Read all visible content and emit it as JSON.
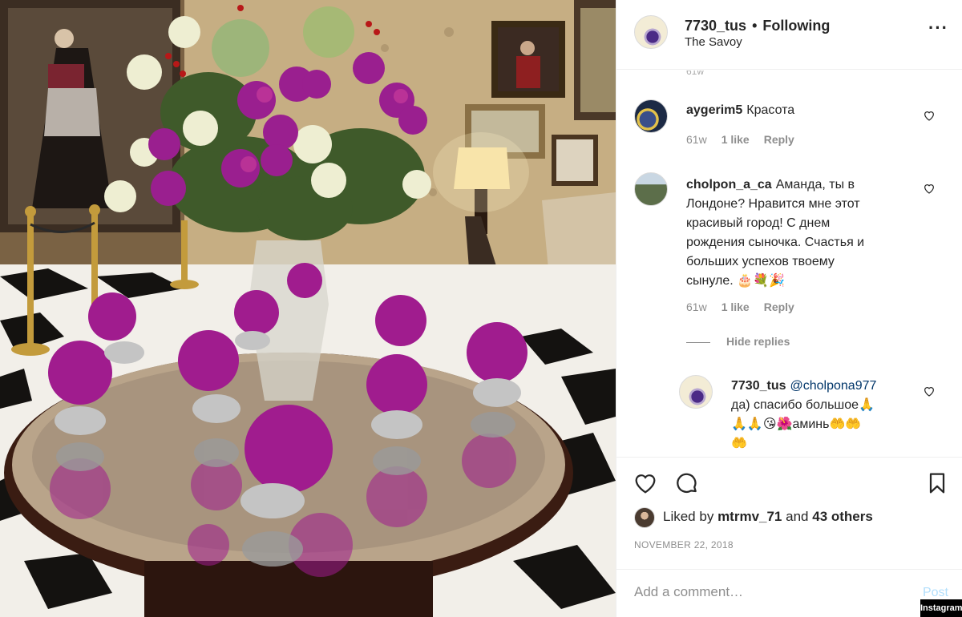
{
  "header": {
    "username": "7730_tus",
    "separator": "•",
    "follow_state": "Following",
    "location": "The Savoy",
    "more_icon": "more-dots-icon"
  },
  "comments": [
    {
      "user": "aygerim5",
      "text": "Красота",
      "time": "61w",
      "likes": "1 like",
      "reply": "Reply"
    },
    {
      "user": "cholpon_a_ca",
      "lines": [
        "Аманда, ты в",
        "Лондоне? Нравится мне этот",
        "красивый город! С днем",
        "рождения сыночка. Счастья и",
        "больших успехов твоему",
        "сынуле. 🎂💐🎉"
      ],
      "time": "61w",
      "likes": "1 like",
      "reply": "Reply"
    }
  ],
  "hide_replies": "Hide replies",
  "reply": {
    "user": "7730_tus",
    "mention": "@cholpona977",
    "lines": [
      "да) спасибо большое🙏",
      "🙏🙏😘🌺аминь🤲🤲",
      "🤲"
    ]
  },
  "actions": {
    "like_icon": "heart-icon",
    "comment_icon": "comment-bubble-icon",
    "save_icon": "bookmark-icon"
  },
  "likes": {
    "prefix": "Liked by",
    "user": "mtrmv_71",
    "mid": "and",
    "others": "43 others"
  },
  "date": "NOVEMBER 22, 2018",
  "add_comment": {
    "placeholder": "Add a comment…",
    "post_label": "Post"
  },
  "watermark": "Instagram"
}
